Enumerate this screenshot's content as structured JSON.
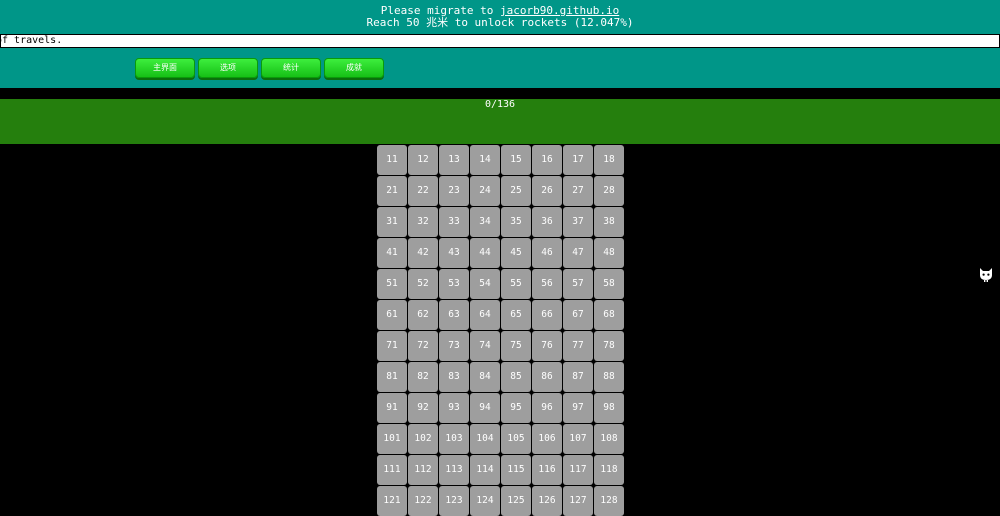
{
  "banner": {
    "notice_prefix": "Please migrate to ",
    "notice_link": "jacorb90.github.io",
    "unlock_text": "Reach 50 兆米 to unlock rockets (12.047%)",
    "news_text": "of travels.",
    "bg_color": "#009688"
  },
  "tabs": [
    {
      "label": "主界面"
    },
    {
      "label": "选项"
    },
    {
      "label": "统计"
    },
    {
      "label": "成就"
    }
  ],
  "achievements": {
    "progress_text": "0/136",
    "bar_color": "#257f0d",
    "tile_color": "#9e9e9e",
    "tiles": [
      "11",
      "12",
      "13",
      "14",
      "15",
      "16",
      "17",
      "18",
      "21",
      "22",
      "23",
      "24",
      "25",
      "26",
      "27",
      "28",
      "31",
      "32",
      "33",
      "34",
      "35",
      "36",
      "37",
      "38",
      "41",
      "42",
      "43",
      "44",
      "45",
      "46",
      "47",
      "48",
      "51",
      "52",
      "53",
      "54",
      "55",
      "56",
      "57",
      "58",
      "61",
      "62",
      "63",
      "64",
      "65",
      "66",
      "67",
      "68",
      "71",
      "72",
      "73",
      "74",
      "75",
      "76",
      "77",
      "78",
      "81",
      "82",
      "83",
      "84",
      "85",
      "86",
      "87",
      "88",
      "91",
      "92",
      "93",
      "94",
      "95",
      "96",
      "97",
      "98",
      "101",
      "102",
      "103",
      "104",
      "105",
      "106",
      "107",
      "108",
      "111",
      "112",
      "113",
      "114",
      "115",
      "116",
      "117",
      "118",
      "121",
      "122",
      "123",
      "124",
      "125",
      "126",
      "127",
      "128"
    ]
  },
  "side_icon": "github-cat-icon"
}
